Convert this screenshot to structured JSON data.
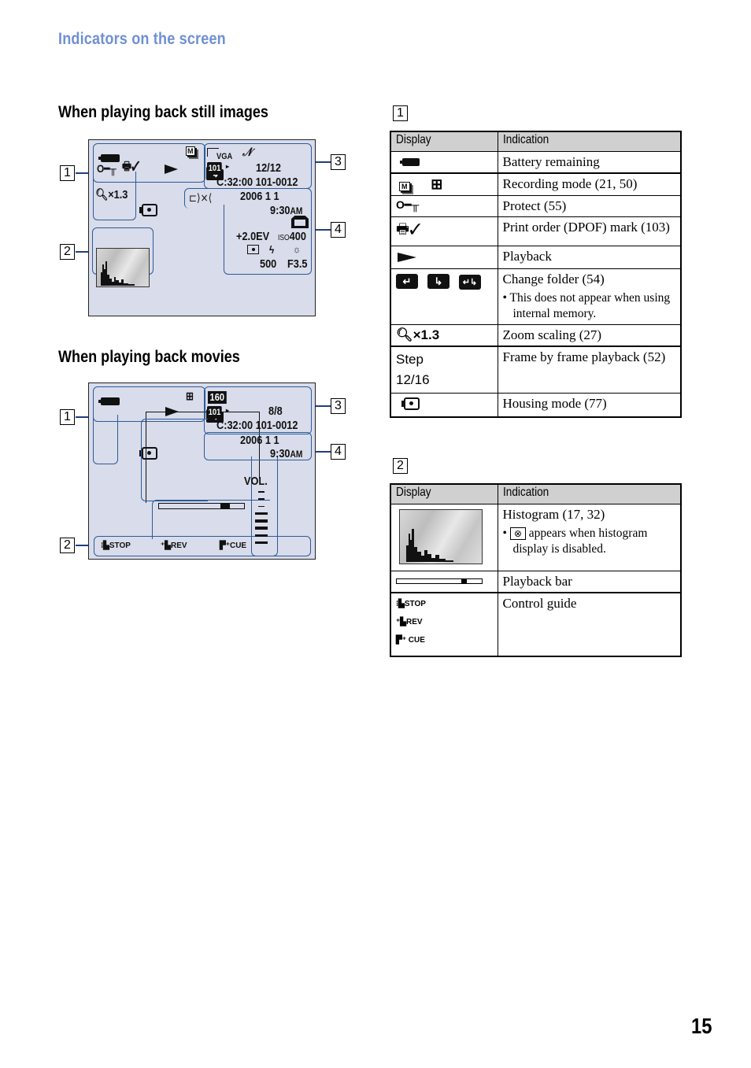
{
  "header": {
    "title": "Indicators on the screen"
  },
  "still_section": {
    "title": "When playing back still images",
    "callouts": [
      "1",
      "2",
      "3",
      "4"
    ],
    "screen": {
      "group1": {
        "icons": [
          "battery-icon",
          "recording-mode-burst-icon",
          "protect-icon",
          "print-order-icon",
          "playback-icon",
          "change-folder-icon",
          "housing-mode-icon"
        ],
        "zoom": "×1.3"
      },
      "group3": {
        "image_size": "VGA",
        "folder": "101",
        "count": "12/12",
        "file": "C:32:00 101-0012"
      },
      "group4": {
        "date": "2006   1   1",
        "time": "9:30",
        "ampm": "AM",
        "ev": "+2.0EV",
        "iso_label": "ISO",
        "iso": "400",
        "shutter": "500",
        "aperture": "F3.5"
      }
    }
  },
  "movie_section": {
    "title": "When playing back movies",
    "callouts": [
      "1",
      "2",
      "3",
      "4"
    ],
    "screen": {
      "image_size": "160",
      "folder": "101",
      "count": "8/8",
      "file": "C:32:00 101-0012",
      "date": "2006   1   1",
      "time": "9:30",
      "ampm": "AM",
      "volume_label": "VOL.",
      "volume_level": 5,
      "volume_max": 8,
      "playback_progress": 0.82,
      "guide": [
        "STOP",
        "REV",
        "CUE"
      ]
    }
  },
  "table1": {
    "label": "1",
    "headers": [
      "Display",
      "Indication"
    ],
    "rows": [
      {
        "display": "battery-icon",
        "indication": "Battery remaining"
      },
      {
        "display": "recording-mode-icons",
        "indication": "Recording mode (21, 50)"
      },
      {
        "display": "protect-icon",
        "indication": "Protect (55)"
      },
      {
        "display": "print-order-icon",
        "indication": "Print order (DPOF) mark (103)"
      },
      {
        "display": "playback-icon",
        "indication": "Playback"
      },
      {
        "display": "change-folder-icons",
        "indication": "Change folder (54)",
        "note": "This does not appear when using internal memory."
      },
      {
        "display_text": "×1.3",
        "indication": "Zoom scaling (27)"
      },
      {
        "display_text": "Step",
        "display_text2": "12/16",
        "indication": "Frame by frame playback (52)"
      },
      {
        "display": "housing-mode-icon",
        "indication": "Housing mode (77)"
      }
    ]
  },
  "table2": {
    "label": "2",
    "headers": [
      "Display",
      "Indication"
    ],
    "rows": [
      {
        "display": "histogram",
        "indication": "Histogram (17, 32)",
        "note_symbol": "⊗",
        "note": "appears when histogram display is disabled."
      },
      {
        "display": "playback-bar",
        "playback_progress": 0.82,
        "indication": "Playback bar"
      },
      {
        "display_guide": [
          "STOP",
          "REV",
          "CUE"
        ],
        "indication": "Control guide"
      }
    ]
  },
  "page_number": "15"
}
